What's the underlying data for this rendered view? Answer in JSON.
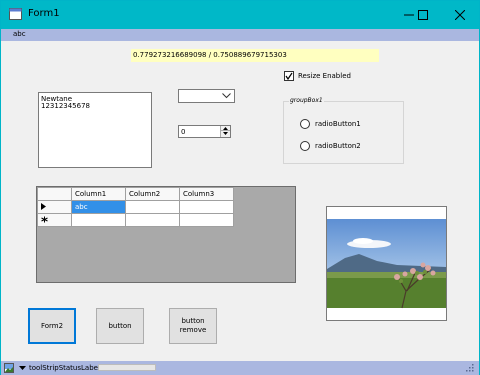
{
  "window": {
    "title": "Form1"
  },
  "menu": {
    "items": [
      "abc"
    ]
  },
  "ratio_label": "0.779273216689098 / 0.750889679715303",
  "resize_checkbox": {
    "label": "Resize Enabled",
    "checked": true
  },
  "textbox": {
    "value": "Newtane\n12312345678"
  },
  "combo": {
    "value": ""
  },
  "numeric": {
    "value": "0"
  },
  "groupbox": {
    "title": "groupBox1",
    "radios": [
      {
        "label": "radioButton1",
        "checked": false
      },
      {
        "label": "radioButton2",
        "checked": false
      }
    ]
  },
  "datagrid": {
    "columns": [
      "Column1",
      "Column2",
      "Column3"
    ],
    "rows": [
      {
        "marker": "current",
        "cells": [
          "abc",
          "",
          ""
        ]
      },
      {
        "marker": "new",
        "cells": [
          "",
          "",
          ""
        ]
      }
    ]
  },
  "buttons": {
    "form2": "Form2",
    "button": "button",
    "button_remove": "button remove"
  },
  "status": {
    "label": "toolStripStatusLabel1",
    "progress": 0
  },
  "colors": {
    "titlebar": "#00b8c8",
    "menubar": "#aab7e0",
    "selection": "#3290e8",
    "label_bg": "#ffffc0"
  },
  "icons": [
    "app-icon",
    "minimize-icon",
    "maximize-icon",
    "close-icon",
    "chevron-down-icon",
    "checkmark-icon",
    "spin-up-icon",
    "spin-down-icon",
    "row-pointer-icon",
    "new-row-icon",
    "image-icon",
    "dropdown-arrow-icon",
    "resize-grip-icon"
  ]
}
